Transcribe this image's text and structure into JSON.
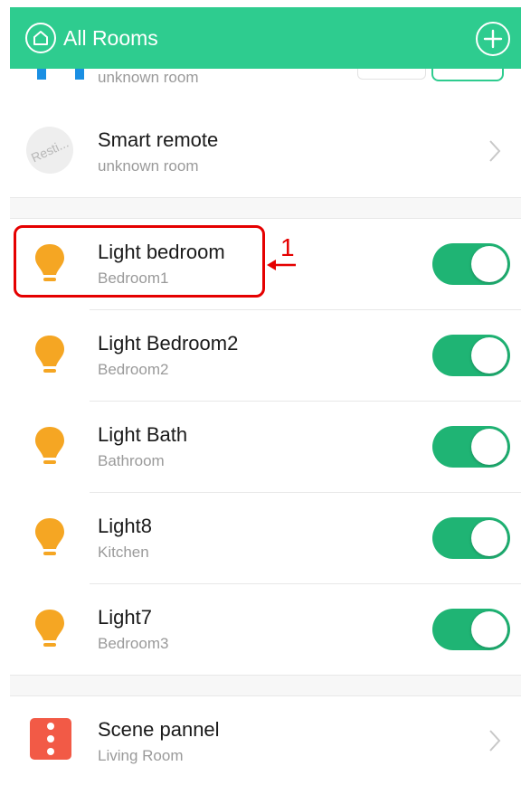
{
  "header": {
    "title": "All Rooms",
    "home_icon": "home-icon",
    "add_icon": "plus-icon",
    "bg_color": "#2ecc8f"
  },
  "partial_row": {
    "room": "unknown room"
  },
  "smart_remote": {
    "name": "Smart remote",
    "room": "unknown room",
    "avatar_text": "Resti..."
  },
  "lights": [
    {
      "name": "Light bedroom",
      "room": "Bedroom1",
      "on": true
    },
    {
      "name": "Light Bedroom2",
      "room": "Bedroom2",
      "on": true
    },
    {
      "name": "Light Bath",
      "room": "Bathroom",
      "on": true
    },
    {
      "name": "Light8",
      "room": "Kitchen",
      "on": true
    },
    {
      "name": "Light7",
      "room": "Bedroom3",
      "on": true
    }
  ],
  "scene": {
    "name": "Scene pannel",
    "room": "Living Room"
  },
  "annotation": {
    "label": "1",
    "color": "#e50000"
  },
  "colors": {
    "toggle_on": "#1fb474",
    "bulb": "#f5a623",
    "scene_icon": "#f25a46"
  }
}
